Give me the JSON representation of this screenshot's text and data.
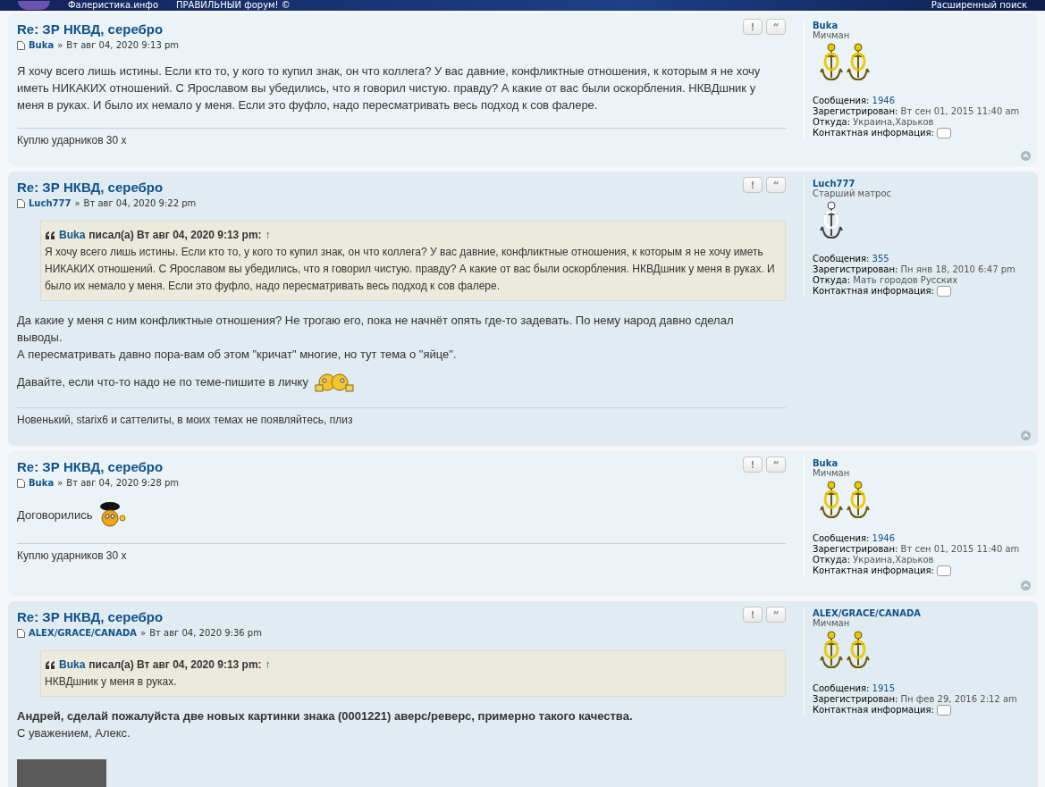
{
  "header": {
    "site_name": "Фалеристика.инфо",
    "slogan": "ПРАВИЛЬНЫЙ форум! ©",
    "advanced_search": "Расширенный поиск"
  },
  "posts": [
    {
      "title": "Re: ЗР НКВД, серебро",
      "author": "Buka",
      "separator": "»",
      "date": "Вт авг 04, 2020 9:13 pm",
      "buttons": [
        "!",
        "“"
      ],
      "content": [
        {
          "kind": "text",
          "text": "Я хочу всего лишь истины. Если кто то, у кого то купил знак, он что коллега? У вас давние, конфликтные отношения, к которым я не хочу иметь НИКАКИХ отношений. С Ярославом вы убедились, что я говорил чистую. правду? А какие от вас были оскорбления. НКВДшник у меня в руках. И было их немало у меня. Если это фуфло, надо пересматривать весь подход к сов фалере."
        }
      ],
      "signature": "Куплю ударников 30 х",
      "profile": {
        "name": "Buka",
        "rank": "Мичман",
        "insignia": [
          {
            "kind": "gold-anchor"
          },
          {
            "kind": "gold-anchor"
          }
        ],
        "fields": [
          {
            "label": "Сообщения:",
            "value": "1946",
            "kind": "link"
          },
          {
            "label": "Зарегистрирован:",
            "value": "Вт сен 01, 2015 11:40 am",
            "kind": "text"
          },
          {
            "label": "Откуда:",
            "value": "Украина,Харьков",
            "kind": "text"
          },
          {
            "label": "Контактная информация:",
            "kind": "contact"
          }
        ]
      }
    },
    {
      "title": "Re: ЗР НКВД, серебро",
      "author": "Luch777",
      "separator": "»",
      "date": "Вт авг 04, 2020 9:22 pm",
      "buttons": [
        "!",
        "“"
      ],
      "quote": {
        "author": "Buka",
        "wrote": "писал(а) Вт авг 04, 2020 9:13 pm:",
        "arrow": "↑",
        "text": "Я хочу всего лишь истины. Если кто то, у кого то купил знак, он что коллега? У вас давние, конфликтные отношения, к которым я не хочу иметь НИКАКИХ отношений. С Ярославом вы убедились, что я говорил чистую. правду? А какие от вас были оскорбления. НКВДшник у меня в руках. И было их немало у меня. Если это фуфло, надо пересматривать весь подход к сов фалере."
      },
      "content": [
        {
          "kind": "text",
          "text": "Да какие у меня с ним конфликтные отношения? Не трогаю его, пока не начнёт опять где-то задевать. По нему народ давно сделал выводы."
        },
        {
          "kind": "text",
          "text": "А пересматривать давно пора-вам об этом \"кричат\" многие, но тут тема о \"яйце\"."
        },
        {
          "kind": "smiley-text",
          "text": "Давайте, если что-то надо не по теме-пишите в личку",
          "smiley": {
            "kind": "beer"
          }
        }
      ],
      "signature": "Новенький, starix6 и саттелиты, в моих темах не появляйтесь, плиз",
      "profile": {
        "name": "Luch777",
        "rank": "Старший матрос",
        "insignia": [
          {
            "kind": "grey-anchor"
          }
        ],
        "fields": [
          {
            "label": "Сообщения:",
            "value": "355",
            "kind": "link"
          },
          {
            "label": "Зарегистрирован:",
            "value": "Пн янв 18, 2010 6:47 pm",
            "kind": "text"
          },
          {
            "label": "Откуда:",
            "value": "Мать городов Русских",
            "kind": "text"
          },
          {
            "label": "Контактная информация:",
            "kind": "contact"
          }
        ]
      }
    },
    {
      "title": "Re: ЗР НКВД, серебро",
      "author": "Buka",
      "separator": "»",
      "date": "Вт авг 04, 2020 9:28 pm",
      "buttons": [
        "!",
        "“"
      ],
      "content": [
        {
          "kind": "smiley-text",
          "text": "Договорились",
          "smiley": {
            "kind": "cap"
          }
        }
      ],
      "signature": "Куплю ударников 30 х",
      "profile": {
        "name": "Buka",
        "rank": "Мичман",
        "insignia": [
          {
            "kind": "gold-anchor"
          },
          {
            "kind": "gold-anchor"
          }
        ],
        "fields": [
          {
            "label": "Сообщения:",
            "value": "1946",
            "kind": "link"
          },
          {
            "label": "Зарегистрирован:",
            "value": "Вт сен 01, 2015 11:40 am",
            "kind": "text"
          },
          {
            "label": "Откуда:",
            "value": "Украина,Харьков",
            "kind": "text"
          },
          {
            "label": "Контактная информация:",
            "kind": "contact"
          }
        ]
      }
    },
    {
      "title": "Re: ЗР НКВД, серебро",
      "author": "ALEX/GRACE/CANADA",
      "separator": "»",
      "date": "Вт авг 04, 2020 9:36 pm",
      "buttons": [
        "!",
        "“"
      ],
      "quote": {
        "author": "Buka",
        "wrote": "писал(а) Вт авг 04, 2020 9:13 pm:",
        "arrow": "↑",
        "text": "НКВДшник у меня в руках."
      },
      "content": [
        {
          "kind": "bold",
          "text": "Андрей, сделай пожалуйста две новых картинки знака (0001221) аверс/реверс, примерно такого качества."
        },
        {
          "kind": "text",
          "text": "С уважением, Алекс."
        },
        {
          "kind": "photo"
        }
      ],
      "profile": {
        "name": "ALEX/GRACE/CANADA",
        "rank": "Мичман",
        "insignia": [
          {
            "kind": "gold-anchor"
          },
          {
            "kind": "gold-anchor"
          }
        ],
        "fields": [
          {
            "label": "Сообщения:",
            "value": "1915",
            "kind": "link"
          },
          {
            "label": "Зарегистрирован:",
            "value": "Пн фев 29, 2016 2:12 am",
            "kind": "text"
          },
          {
            "label": "Контактная информация:",
            "kind": "contact"
          }
        ]
      }
    }
  ]
}
